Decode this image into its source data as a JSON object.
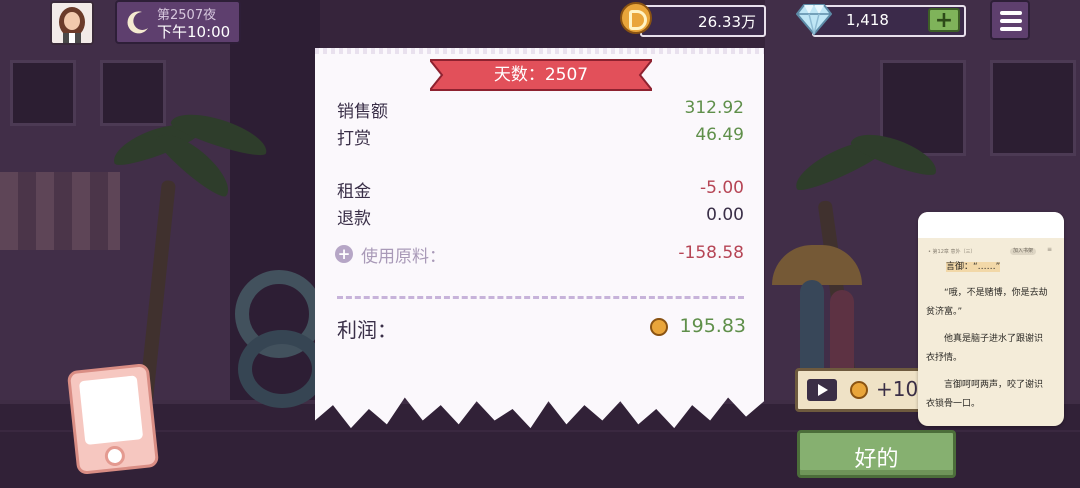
{
  "hud": {
    "night_label": "第2507夜",
    "time_label": "下午10:00",
    "coins": "26.33万",
    "gems": "1,418",
    "add_gems_label": "+"
  },
  "receipt": {
    "title": "天数：2507",
    "rows": [
      {
        "label": "销售额",
        "value": "312.92"
      },
      {
        "label": "打赏",
        "value": "46.49"
      },
      {
        "label": "租金",
        "value": "-5.00"
      },
      {
        "label": "退款",
        "value": "0.00"
      },
      {
        "label": "使用原料：",
        "value": "-158.58"
      }
    ],
    "profit_label": "利润：",
    "profit_value": "195.83"
  },
  "ad_reward": {
    "value": "+10"
  },
  "ok_button": {
    "label": "好的"
  },
  "reader": {
    "chapter": "• 第12章 意外（三）",
    "pill": "加入书架",
    "lines": [
      "言御：“……”",
      "“哦，不是赌博，你是去劫",
      "贫济富。”",
      "他真是脑子进水了跟谢识",
      "衣抒情。",
      "言御呵呵两声，咬了谢识",
      "衣锁骨一口。"
    ]
  },
  "colors": {
    "profit_green": "#5f8f4a",
    "loss_red": "#b64555",
    "ribbon_red": "#e2505a",
    "ok_green": "#86b070"
  }
}
